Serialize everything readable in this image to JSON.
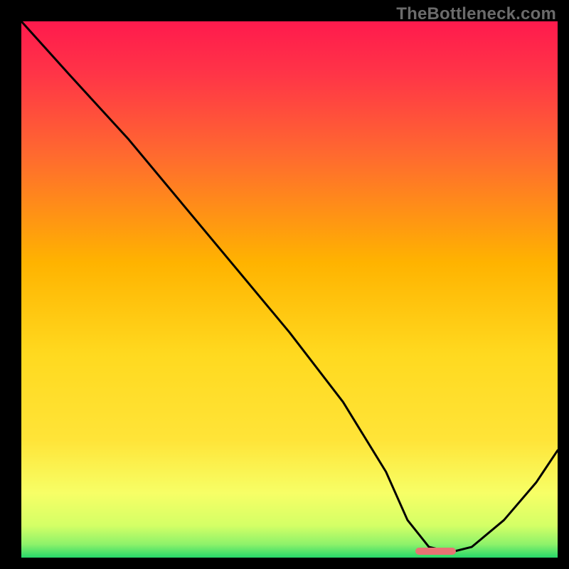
{
  "watermark": "TheBottleneck.com",
  "chart_data": {
    "type": "line",
    "title": "",
    "xlabel": "",
    "ylabel": "",
    "xlim": [
      0,
      100
    ],
    "ylim": [
      0,
      100
    ],
    "grid": false,
    "legend": false,
    "background_gradient": {
      "top_color": "#ff1a4d",
      "mid_colors": [
        "#ff6a2f",
        "#ffb300",
        "#ffe438",
        "#f7ff66"
      ],
      "bottom_color": "#27d86a"
    },
    "series": [
      {
        "name": "bottleneck-curve",
        "color": "#000000",
        "x": [
          0,
          9,
          20,
          30,
          40,
          50,
          60,
          68,
          72,
          76,
          80,
          84,
          90,
          96,
          100
        ],
        "y_pct": [
          100,
          90,
          78,
          66,
          54,
          42,
          29,
          16,
          7,
          2,
          1,
          2,
          7,
          14,
          20
        ]
      }
    ],
    "marker": {
      "name": "optimal-range",
      "color": "#e87373",
      "x_start_pct": 73.5,
      "x_end_pct": 81,
      "y_pct": 1.2
    }
  }
}
